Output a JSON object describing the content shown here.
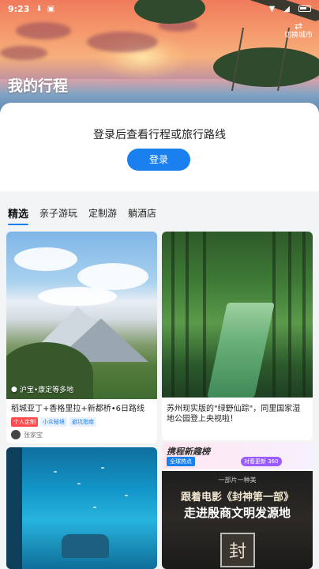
{
  "status_bar": {
    "time": "9:23"
  },
  "header": {
    "title": "我的行程",
    "switch_city_label": "切换城市"
  },
  "login": {
    "prompt": "登录后查看行程或旅行路线",
    "button_label": "登录"
  },
  "tabs": [
    {
      "label": "精选",
      "active": true
    },
    {
      "label": "亲子游玩",
      "active": false
    },
    {
      "label": "定制游",
      "active": false
    },
    {
      "label": "躺酒店",
      "active": false
    }
  ],
  "feed": {
    "card1": {
      "location": "沪宝•康定等多地",
      "title": "稻城亚丁+香格里拉+新都桥•6日路线",
      "badges": [
        "个人定制",
        "小众秘境",
        "避坑指南"
      ],
      "author": "张家宝"
    },
    "card2": {
      "title": "苏州现实版的\"绿野仙踪\"，同里国家湿地公园登上央视啦！"
    },
    "card3": {},
    "card4": {
      "banner_title": "携程新趣榜",
      "banner_tag": "全球热点",
      "banner_count": "对春更新 360",
      "poster_line1": "一部片一种美",
      "poster_line2": "跟着电影《封神第一部》",
      "poster_line3": "走进殷商文明发源地",
      "seal_char": "封"
    }
  }
}
